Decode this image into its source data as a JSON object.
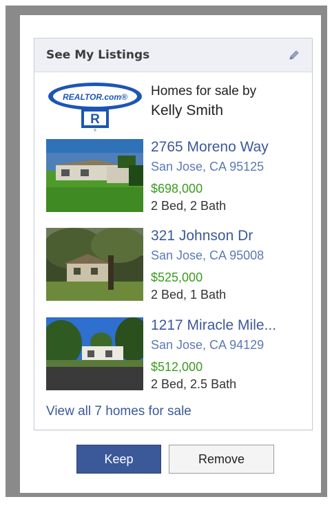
{
  "card": {
    "title": "See My Listings",
    "edit_icon": "pencil-icon"
  },
  "agent": {
    "logo_text": "REALTOR.com",
    "logo_icon": "realtor-r-logo",
    "line1": "Homes for sale by",
    "name": "Kelly Smith"
  },
  "listings": [
    {
      "address": "2765 Moreno Way",
      "city": "San Jose, CA 95125",
      "price": "$698,000",
      "beds": "2 Bed, 2 Bath"
    },
    {
      "address": "321 Johnson Dr",
      "city": "San Jose, CA 95008",
      "price": "$525,000",
      "beds": "2 Bed, 1 Bath"
    },
    {
      "address": "1217 Miracle Mile...",
      "city": "San Jose, CA 94129",
      "price": "$512,000",
      "beds": "2 Bed, 2.5 Bath"
    }
  ],
  "view_all": "View all 7 homes for sale",
  "buttons": {
    "keep": "Keep",
    "remove": "Remove"
  },
  "colors": {
    "link": "#3b5998",
    "price": "#3a9a1f",
    "keep_button": "#3b5998"
  }
}
